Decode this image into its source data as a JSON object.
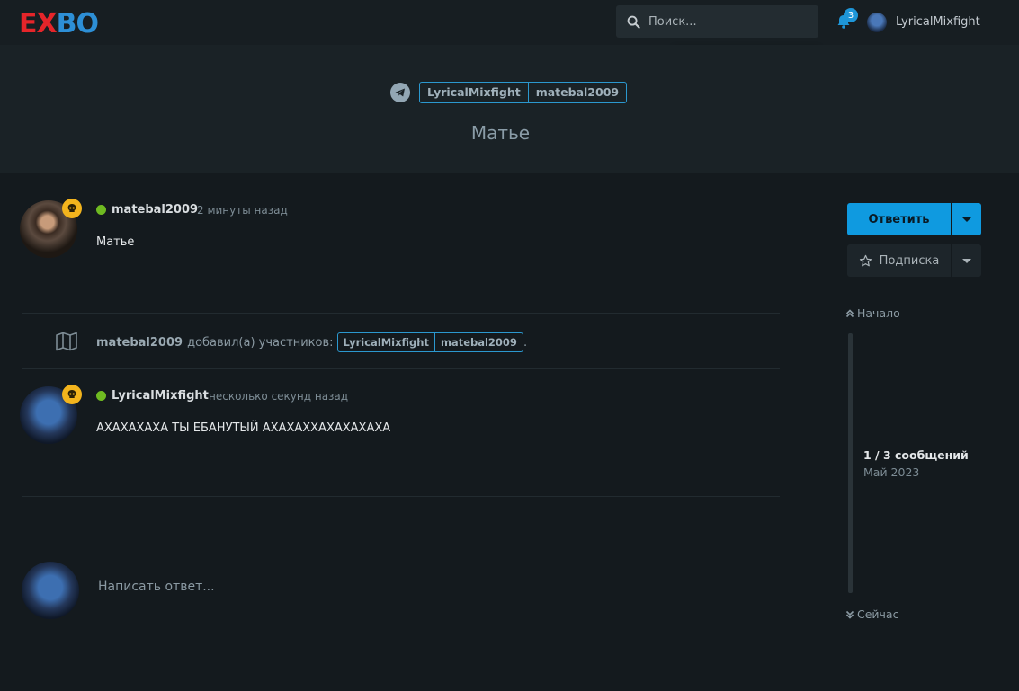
{
  "header": {
    "logo_part1": "EX",
    "logo_part2": "BO",
    "search_placeholder": "Поиск...",
    "notifications_count": "3",
    "username": "LyricalMixfight"
  },
  "hero": {
    "tags": [
      "LyricalMixfight",
      "matebal2009"
    ],
    "title": "Матье"
  },
  "posts": [
    {
      "user": "matebal2009",
      "time": "2 минуты назад",
      "text": "Матье"
    },
    {
      "user": "LyricalMixfight",
      "time": "несколько секунд назад",
      "text": "АХАХАХАХА ТЫ ЕБАНУТЫЙ АХАХАХХАХАХАХАХА"
    }
  ],
  "event": {
    "user": "matebal2009",
    "action": "добавил(а) участников:",
    "tags": [
      "LyricalMixfight",
      "matebal2009"
    ],
    "end": "."
  },
  "composer": {
    "placeholder": "Написать ответ..."
  },
  "sidebar": {
    "reply_label": "Ответить",
    "subscribe_label": "Подписка",
    "scrub_start": "Начало",
    "scrub_count": "1 / 3 сообщений",
    "scrub_date": "Май 2023",
    "scrub_end": "Сейчас"
  },
  "colors": {
    "accent": "#0f9ae0",
    "online": "#6fba21",
    "badge": "#f3b41d",
    "logo_red": "#e5252a",
    "logo_blue": "#2d8fd6"
  },
  "icons": [
    "search-icon",
    "bell-icon",
    "telegram-icon",
    "skull-icon",
    "map-icon",
    "star-icon",
    "chevron-up-double-icon",
    "chevron-down-double-icon"
  ]
}
